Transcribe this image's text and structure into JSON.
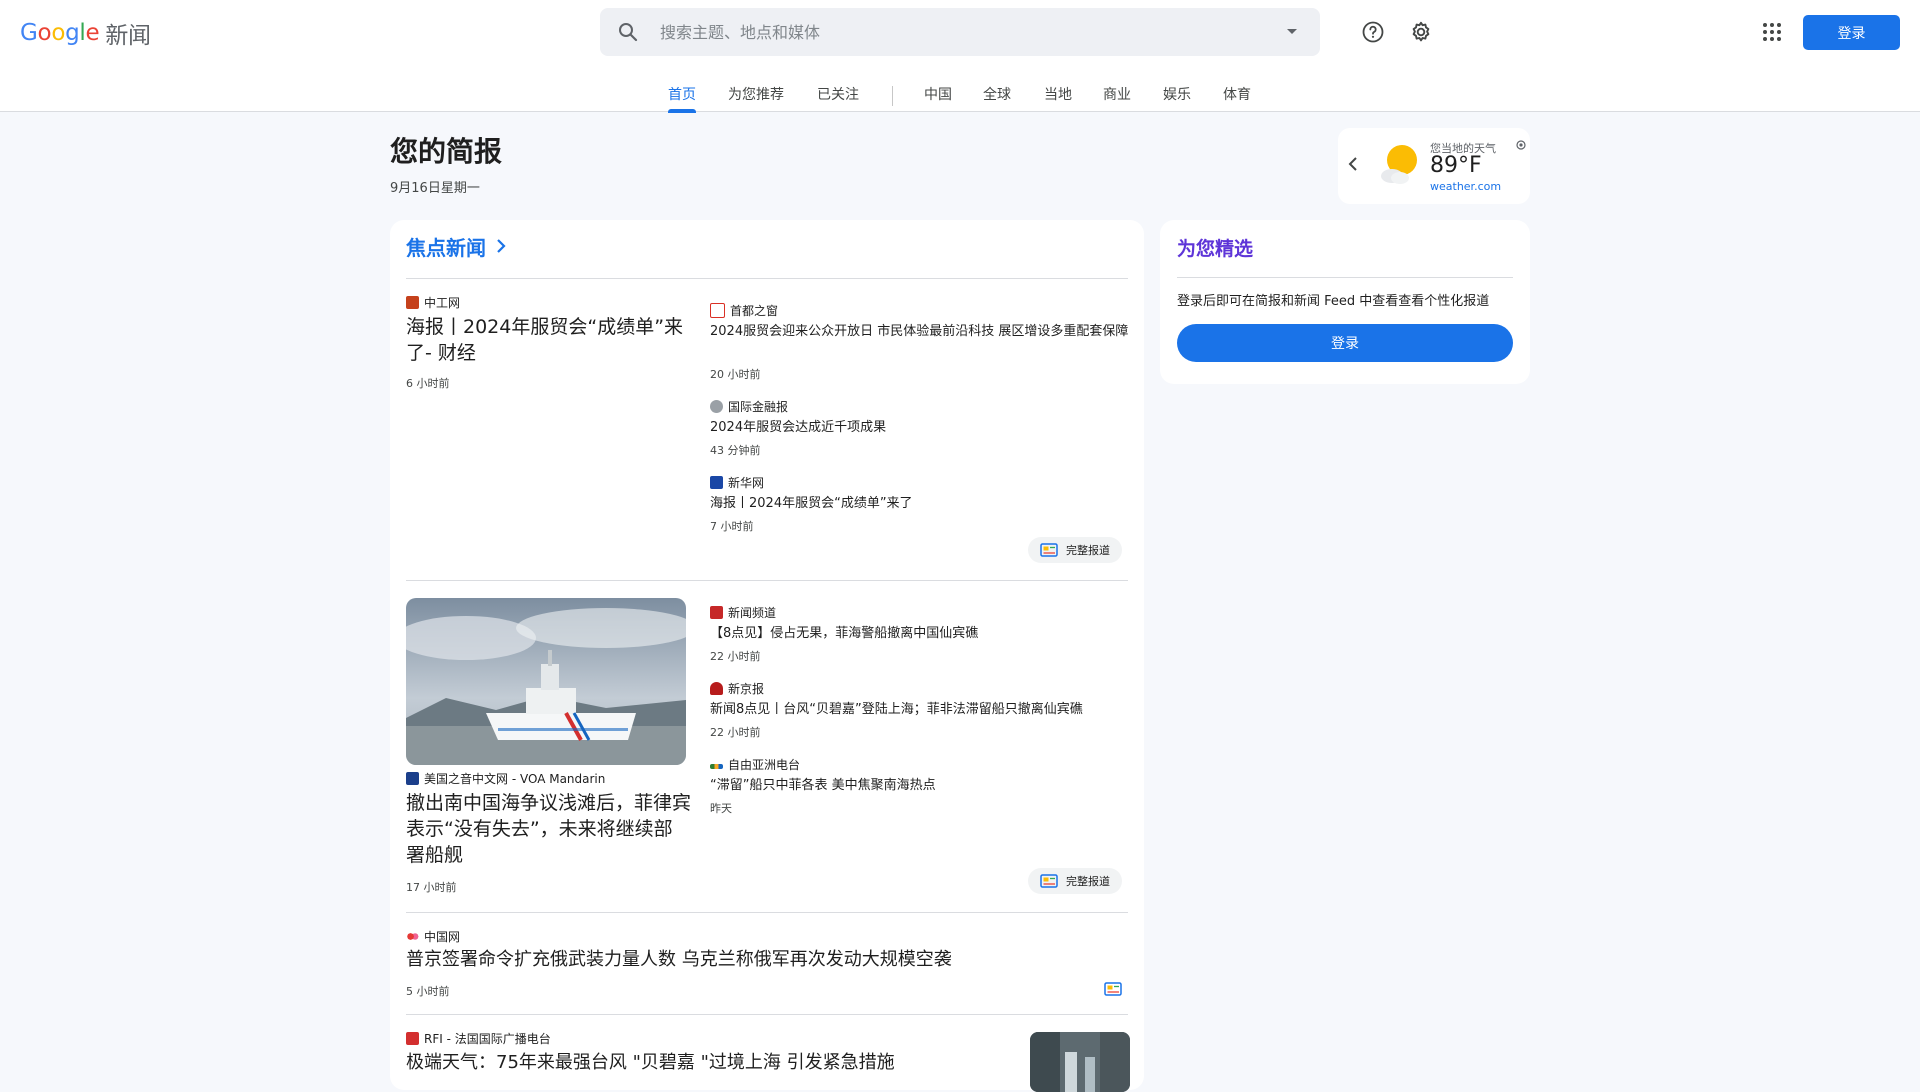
{
  "header": {
    "logo_google": "Google",
    "logo_news": "新闻",
    "search_placeholder": "搜索主题、地点和媒体",
    "signin_label": "登录"
  },
  "nav": {
    "items": [
      "首页",
      "为您推荐",
      "已关注",
      "中国",
      "全球",
      "当地",
      "商业",
      "娱乐",
      "体育"
    ],
    "active": "首页"
  },
  "briefing": {
    "title": "您的简报",
    "date": "9月16日星期一"
  },
  "weather": {
    "label": "您当地的天气",
    "temp": "89°F",
    "source": "weather.com"
  },
  "top_stories": {
    "title": "焦点新闻",
    "full_coverage_label": "完整报道",
    "cluster1": {
      "main": {
        "source": "中工网",
        "headline": "海报丨2024年服贸会“成绩单”来了- 财经",
        "time": "6 小时前"
      },
      "related": [
        {
          "source": "首都之窗",
          "headline": "2024服贸会迎来公众开放日 市民体验最前沿科技 展区增设多重配套保障",
          "time": "20 小时前"
        },
        {
          "source": "国际金融报",
          "headline": "2024年服贸会达成近千项成果",
          "time": "43 分钟前"
        },
        {
          "source": "新华网",
          "headline": "海报丨2024年服贸会“成绩单”来了",
          "time": "7 小时前"
        }
      ]
    },
    "cluster2": {
      "main": {
        "source": "美国之音中文网 - VOA Mandarin",
        "headline": "撤出南中国海争议浅滩后，菲律宾表示“没有失去”，未来将继续部署船舰",
        "time": "17 小时前"
      },
      "related": [
        {
          "source": "新闻频道",
          "headline": "【8点见】侵占无果，菲海警船撤离中国仙宾礁",
          "time": "22 小时前"
        },
        {
          "source": "新京报",
          "headline": "新闻8点见丨台风“贝碧嘉”登陆上海；菲非法滞留船只撤离仙宾礁",
          "time": "22 小时前"
        },
        {
          "source": "自由亚洲电台",
          "headline": "“滞留”船只中菲各表 美中焦聚南海热点",
          "time": "昨天"
        }
      ]
    },
    "story3": {
      "source": "中国网",
      "headline": "普京签署命令扩充俄武装力量人数 乌克兰称俄军再次发动大规模空袭",
      "time": "5 小时前"
    },
    "story4": {
      "source": "RFI - 法国国际广播电台",
      "headline": "极端天气：75年来最强台风 \"贝碧嘉 \"过境上海 引发紧急措施"
    }
  },
  "picks": {
    "title": "为您精选",
    "text": "登录后即可在简报和新闻 Feed 中查看查看个性化报道",
    "button": "登录"
  },
  "colors": {
    "accent": "#1a73e8",
    "picks_title": "#5e35d8",
    "background": "#f6f8fc"
  }
}
